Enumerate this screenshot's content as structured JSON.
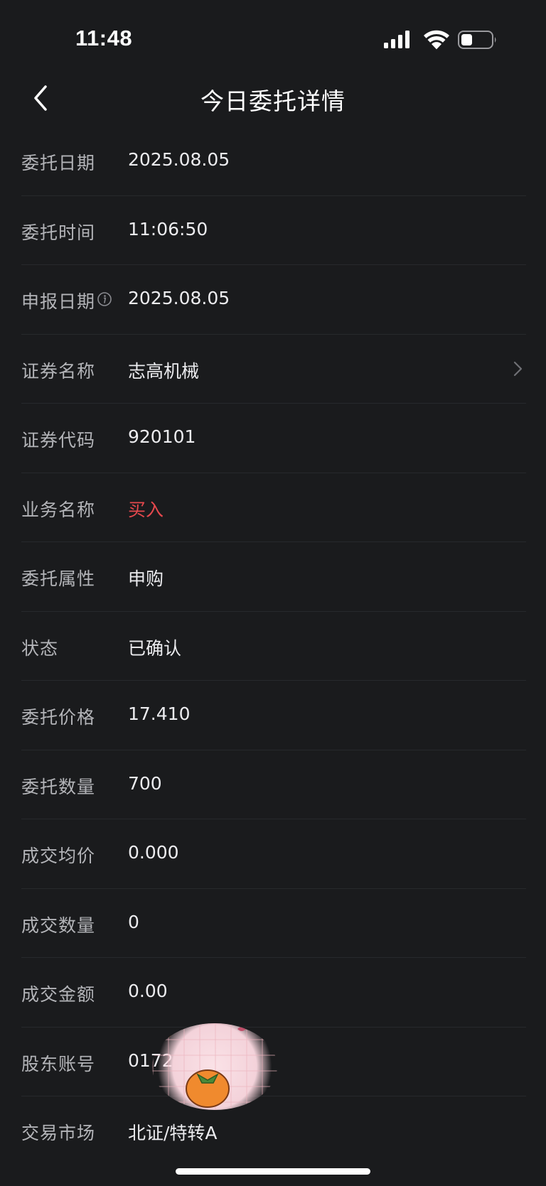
{
  "status_bar": {
    "time": "11:48"
  },
  "nav": {
    "title": "今日委托详情"
  },
  "rows": [
    {
      "label": "委托日期",
      "value": "2025.08.05"
    },
    {
      "label": "委托时间",
      "value": "11:06:50"
    },
    {
      "label": "申报日期",
      "value": "2025.08.05"
    },
    {
      "label": "证券名称",
      "value": "志高机械"
    },
    {
      "label": "证券代码",
      "value": "920101"
    },
    {
      "label": "业务名称",
      "value": "买入",
      "value_color": "#e5484d"
    },
    {
      "label": "委托属性",
      "value": "申购"
    },
    {
      "label": "状态",
      "value": "已确认"
    },
    {
      "label": "委托价格",
      "value": "17.410"
    },
    {
      "label": "委托数量",
      "value": "700"
    },
    {
      "label": "成交均价",
      "value": "0.000"
    },
    {
      "label": "成交数量",
      "value": "0"
    },
    {
      "label": "成交金额",
      "value": "0.00"
    },
    {
      "label": "股东账号",
      "value": "0172"
    },
    {
      "label": "交易市场",
      "value": "北证/特转A"
    }
  ],
  "icons": {
    "back": "chevron-left-icon",
    "info": "info-icon",
    "detail": "chevron-right-icon",
    "signal": "cellular-signal-icon",
    "wifi": "wifi-icon",
    "battery": "battery-icon"
  },
  "colors": {
    "background": "#1a1b1d",
    "label": "#b3b4b8",
    "value": "#ececef",
    "accent_red": "#e5484d"
  }
}
